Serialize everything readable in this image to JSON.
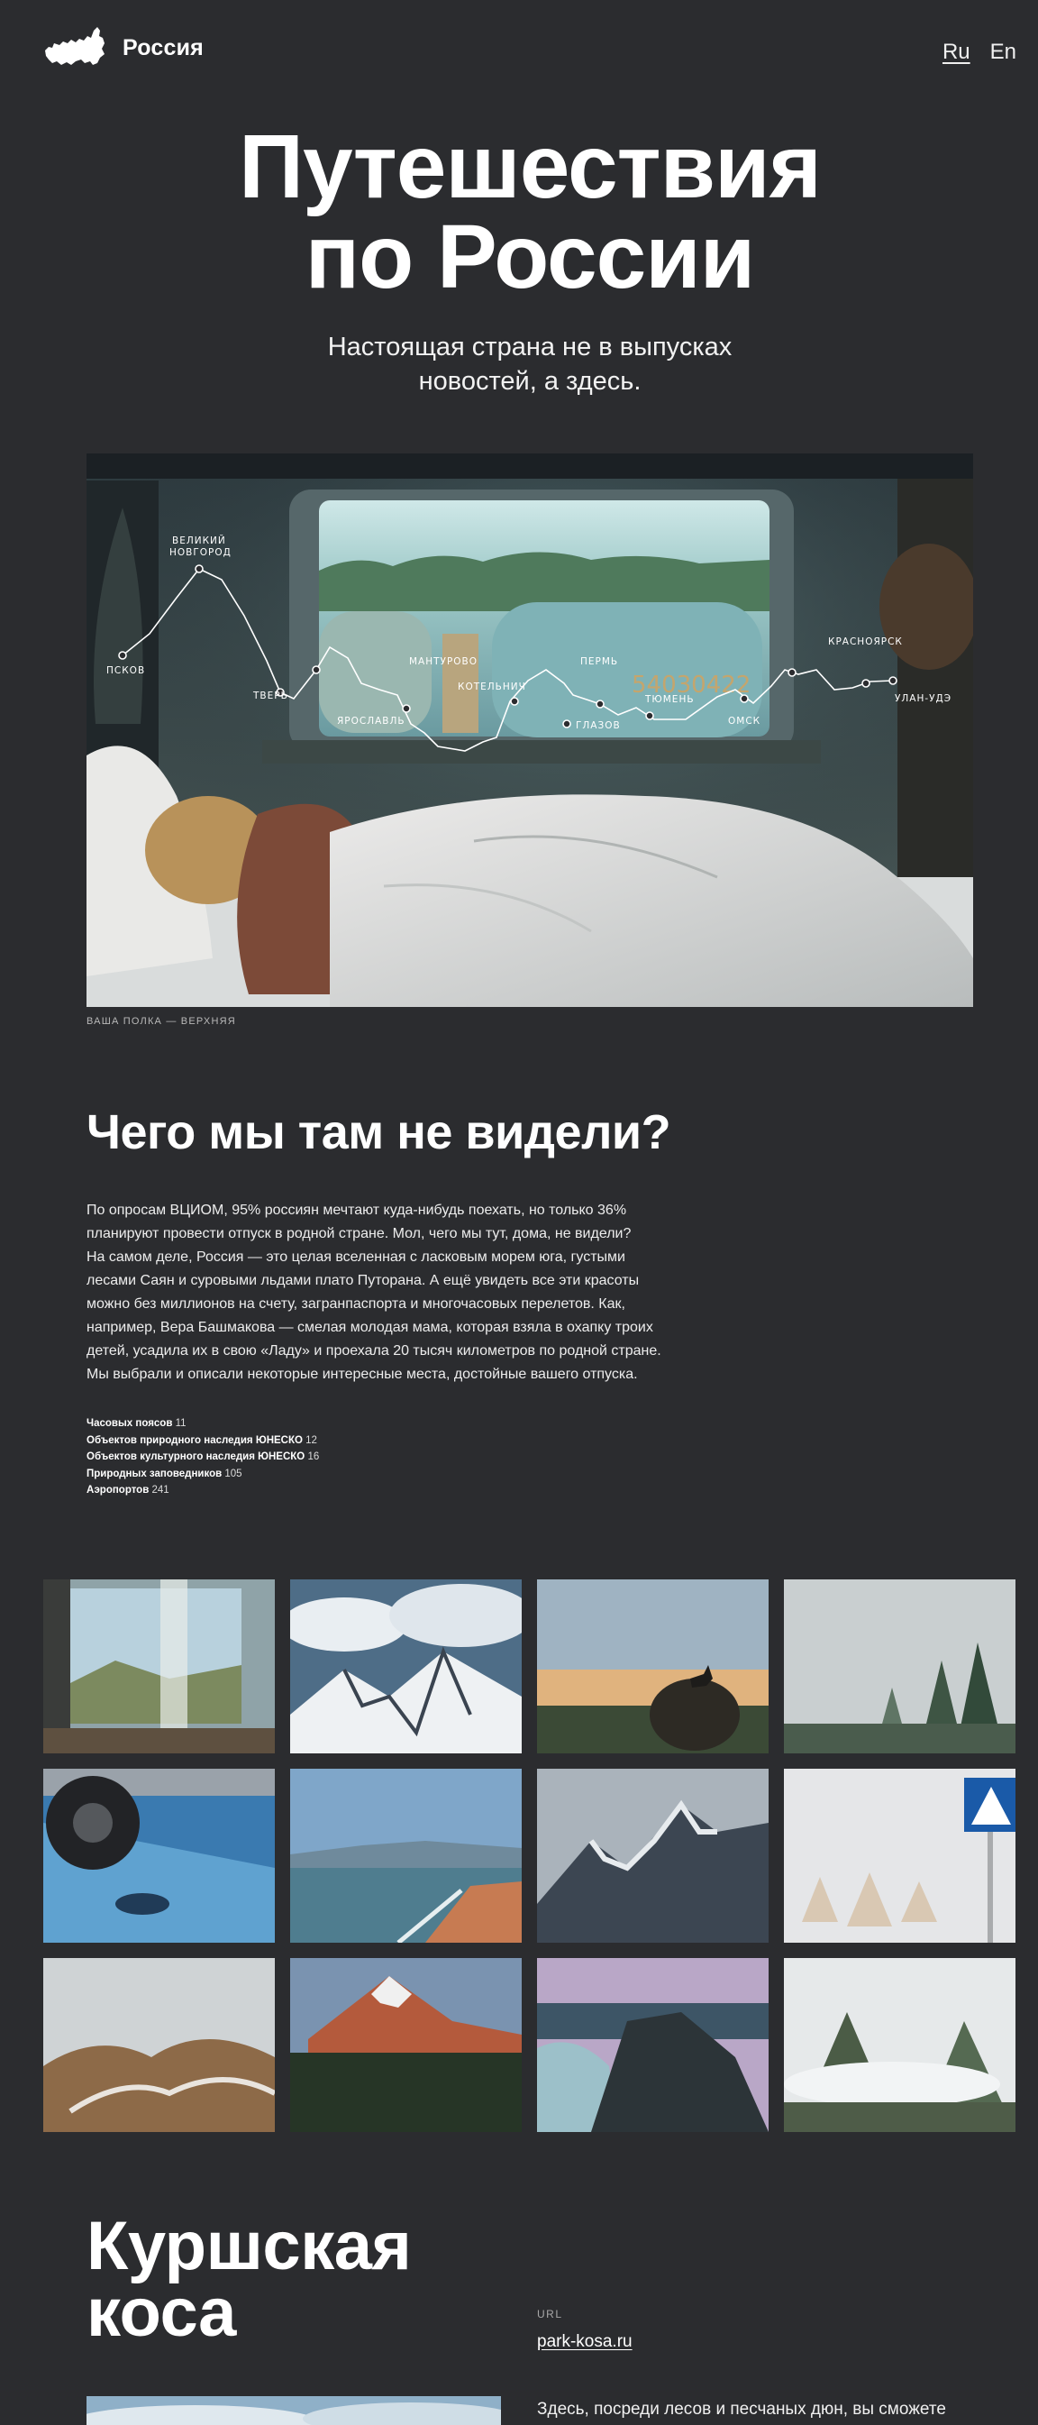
{
  "header": {
    "logo_text": "Россия",
    "languages": [
      {
        "label": "Ru",
        "active": true
      },
      {
        "label": "En",
        "active": false
      }
    ]
  },
  "hero": {
    "title_line1": "Путешествия",
    "title_line2": "по России",
    "subtitle_line1": "Настоящая страна не в выпусках",
    "subtitle_line2": "новостей, а здесь.",
    "photo_caption": "ВАША ПОЛКА — ВЕРХНЯЯ",
    "route_stops": [
      "ПСКОВ",
      "ВЕЛИКИЙ",
      "НОВГОРОД",
      "ТВЕРЬ",
      "ЯРОСЛАВЛЬ",
      "МАНТУРОВО",
      "КОТЕЛЬНИЧ",
      "ГЛАЗОВ",
      "ПЕРМЬ",
      "ТЮМЕНЬ",
      "ОМСК",
      "КРАСНОЯРСК",
      "УЛАН-УДЭ"
    ]
  },
  "about": {
    "title": "Чего мы там не видели?",
    "paragraph_lines": [
      "По опросам ВЦИОМ, 95% россиян мечтают куда-нибудь поехать, но только 36%",
      "планируют провести отпуск в родной стране. Мол, чего мы тут, дома, не видели?",
      "На самом деле, Россия — это целая вселенная с ласковым морем юга, густыми",
      "лесами Саян и суровыми льдами плато Путорана. А ещё увидеть все эти красоты",
      "можно без миллионов на счету, загранпаспорта и многочасовых перелетов. Как,",
      "например, Вера Башмакова — смелая молодая мама, которая взяла в охапку троих",
      "детей, усадила их в свою «Ладу» и проехала 20 тысяч километров по родной стране.",
      "Мы выбрали и описали некоторые интересные места, достойные вашего отпуска."
    ],
    "stats": [
      {
        "label": "Часовых поясов",
        "value": "11"
      },
      {
        "label": "Объектов природного наследия ЮНЕСКО",
        "value": "12"
      },
      {
        "label": "Объектов культурного наследия ЮНЕСКО",
        "value": "16"
      },
      {
        "label": "Природных заповедников",
        "value": "105"
      },
      {
        "label": "Аэропортов",
        "value": "241"
      }
    ]
  },
  "place": {
    "title_line1": "Куршская",
    "title_line2": "коса",
    "url_label": "URL",
    "url": "park-kosa.ru",
    "text": "Здесь, посреди лесов и песчаных дюн, вы сможете"
  },
  "colors": {
    "background": "#2b2c2f",
    "text": "#ffffff"
  }
}
